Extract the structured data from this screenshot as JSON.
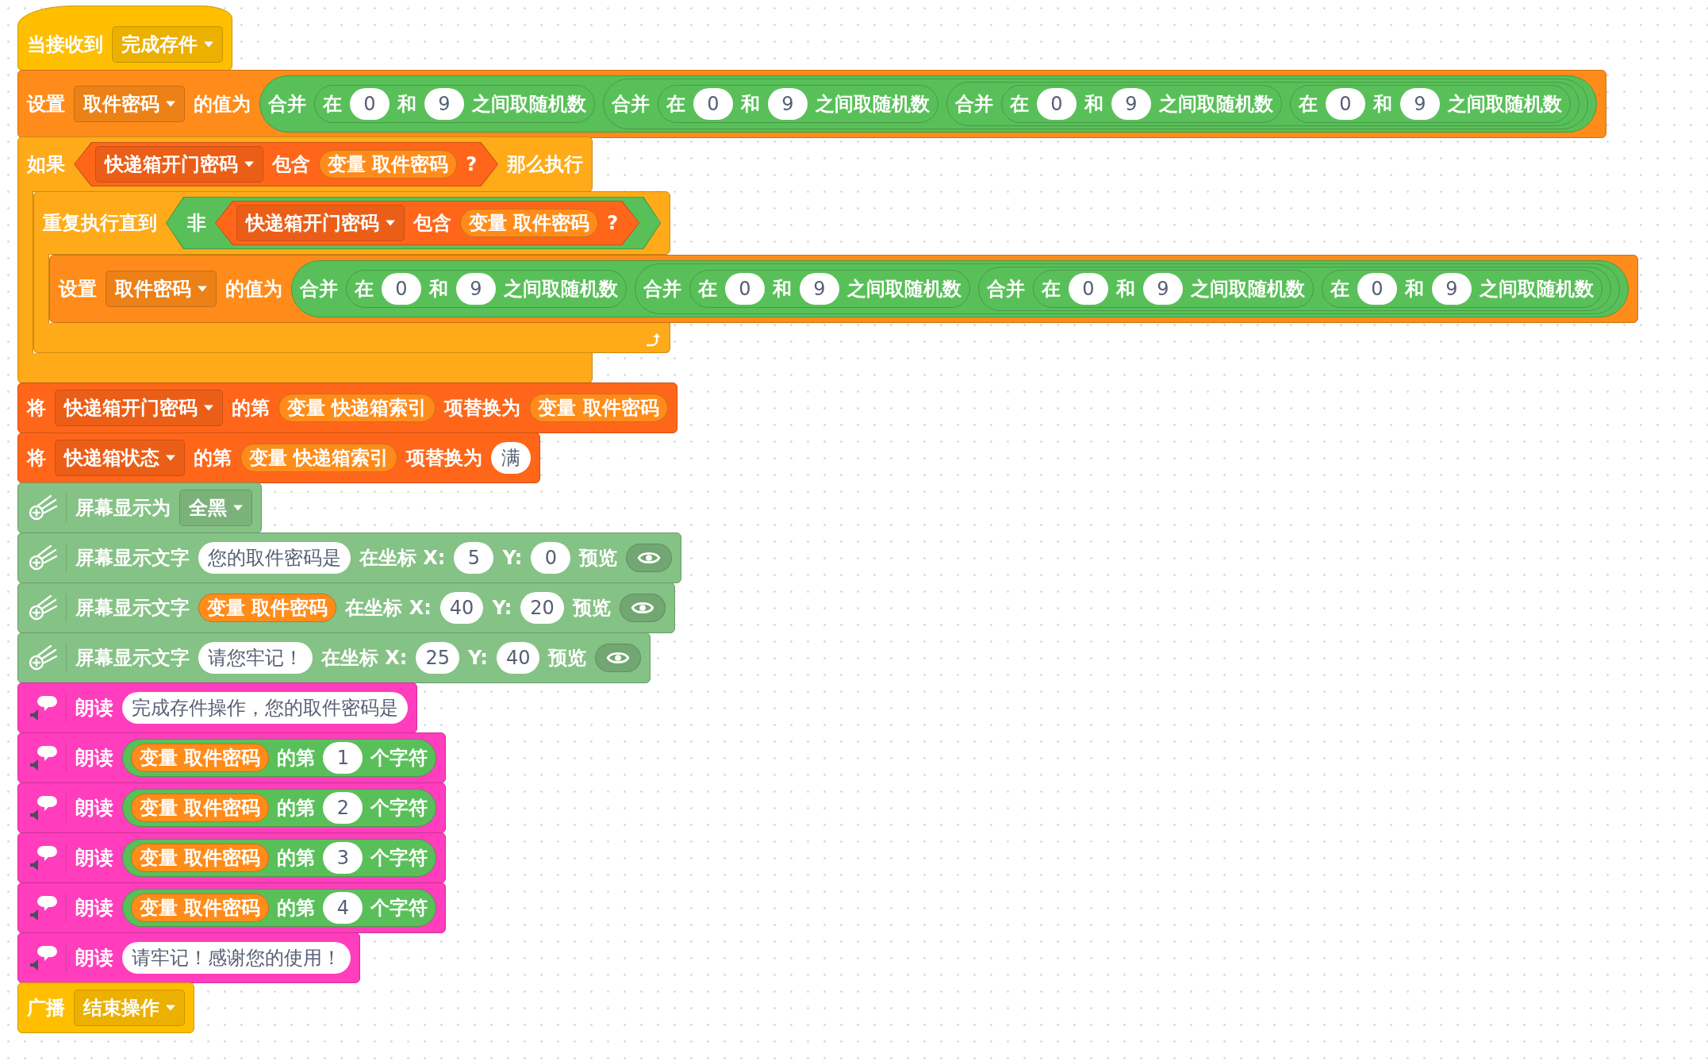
{
  "script": [
    {
      "kind": "hat",
      "color": "#ffbf00",
      "parts": [
        {
          "kind": "label",
          "text": "当接收到"
        },
        {
          "kind": "dropdown",
          "text": "完成存件"
        }
      ]
    },
    {
      "kind": "stack",
      "color": "#ff8c1a",
      "parts": [
        {
          "kind": "label",
          "text": "设置"
        },
        {
          "kind": "dropdown",
          "text": "取件密码"
        },
        {
          "kind": "label",
          "text": "的值为"
        },
        {
          "kind": "reporter",
          "color": "#59c059",
          "parts": [
            {
              "kind": "label",
              "text": "合并"
            },
            {
              "kind": "reporter",
              "color": "#59c059",
              "parts": [
                {
                  "kind": "label",
                  "text": "在"
                },
                {
                  "kind": "input",
                  "text": "0"
                },
                {
                  "kind": "label",
                  "text": "和"
                },
                {
                  "kind": "input",
                  "text": "9"
                },
                {
                  "kind": "label",
                  "text": "之间取随机数"
                }
              ]
            },
            {
              "kind": "reporter",
              "color": "#59c059",
              "parts": [
                {
                  "kind": "label",
                  "text": "合并"
                },
                {
                  "kind": "reporter",
                  "color": "#59c059",
                  "parts": [
                    {
                      "kind": "label",
                      "text": "在"
                    },
                    {
                      "kind": "input",
                      "text": "0"
                    },
                    {
                      "kind": "label",
                      "text": "和"
                    },
                    {
                      "kind": "input",
                      "text": "9"
                    },
                    {
                      "kind": "label",
                      "text": "之间取随机数"
                    }
                  ]
                },
                {
                  "kind": "reporter",
                  "color": "#59c059",
                  "parts": [
                    {
                      "kind": "label",
                      "text": "合并"
                    },
                    {
                      "kind": "reporter",
                      "color": "#59c059",
                      "parts": [
                        {
                          "kind": "label",
                          "text": "在"
                        },
                        {
                          "kind": "input",
                          "text": "0"
                        },
                        {
                          "kind": "label",
                          "text": "和"
                        },
                        {
                          "kind": "input",
                          "text": "9"
                        },
                        {
                          "kind": "label",
                          "text": "之间取随机数"
                        }
                      ]
                    },
                    {
                      "kind": "reporter",
                      "color": "#59c059",
                      "parts": [
                        {
                          "kind": "label",
                          "text": "在"
                        },
                        {
                          "kind": "input",
                          "text": "0"
                        },
                        {
                          "kind": "label",
                          "text": "和"
                        },
                        {
                          "kind": "input",
                          "text": "9"
                        },
                        {
                          "kind": "label",
                          "text": "之间取随机数"
                        }
                      ]
                    }
                  ]
                }
              ]
            }
          ]
        }
      ]
    },
    {
      "kind": "if",
      "color": "#ffab19",
      "parts": [
        {
          "kind": "label",
          "text": "如果"
        },
        {
          "kind": "boolean",
          "color": "#ff661a",
          "parts": [
            {
              "kind": "dropdown",
              "text": "快递箱开门密码"
            },
            {
              "kind": "label",
              "text": "包含"
            },
            {
              "kind": "reporter",
              "color": "#ff8c1a",
              "parts": [
                {
                  "kind": "label",
                  "text": "变量 取件密码"
                }
              ]
            },
            {
              "kind": "label",
              "text": "?"
            }
          ]
        },
        {
          "kind": "label",
          "text": "那么执行"
        }
      ],
      "body": [
        {
          "kind": "repeat",
          "color": "#ffab19",
          "parts": [
            {
              "kind": "label",
              "text": "重复执行直到"
            },
            {
              "kind": "boolean",
              "color": "#59c059",
              "parts": [
                {
                  "kind": "label",
                  "text": "非"
                },
                {
                  "kind": "boolean",
                  "color": "#ff661a",
                  "parts": [
                    {
                      "kind": "dropdown",
                      "text": "快递箱开门密码"
                    },
                    {
                      "kind": "label",
                      "text": "包含"
                    },
                    {
                      "kind": "reporter",
                      "color": "#ff8c1a",
                      "parts": [
                        {
                          "kind": "label",
                          "text": "变量 取件密码"
                        }
                      ]
                    },
                    {
                      "kind": "label",
                      "text": "?"
                    }
                  ]
                }
              ]
            }
          ],
          "body": [
            {
              "kind": "stack",
              "color": "#ff8c1a",
              "parts": [
                {
                  "kind": "label",
                  "text": "设置"
                },
                {
                  "kind": "dropdown",
                  "text": "取件密码"
                },
                {
                  "kind": "label",
                  "text": "的值为"
                },
                {
                  "kind": "reporter",
                  "color": "#59c059",
                  "parts": [
                    {
                      "kind": "label",
                      "text": "合并"
                    },
                    {
                      "kind": "reporter",
                      "color": "#59c059",
                      "parts": [
                        {
                          "kind": "label",
                          "text": "在"
                        },
                        {
                          "kind": "input",
                          "text": "0"
                        },
                        {
                          "kind": "label",
                          "text": "和"
                        },
                        {
                          "kind": "input",
                          "text": "9"
                        },
                        {
                          "kind": "label",
                          "text": "之间取随机数"
                        }
                      ]
                    },
                    {
                      "kind": "reporter",
                      "color": "#59c059",
                      "parts": [
                        {
                          "kind": "label",
                          "text": "合并"
                        },
                        {
                          "kind": "reporter",
                          "color": "#59c059",
                          "parts": [
                            {
                              "kind": "label",
                              "text": "在"
                            },
                            {
                              "kind": "input",
                              "text": "0"
                            },
                            {
                              "kind": "label",
                              "text": "和"
                            },
                            {
                              "kind": "input",
                              "text": "9"
                            },
                            {
                              "kind": "label",
                              "text": "之间取随机数"
                            }
                          ]
                        },
                        {
                          "kind": "reporter",
                          "color": "#59c059",
                          "parts": [
                            {
                              "kind": "label",
                              "text": "合并"
                            },
                            {
                              "kind": "reporter",
                              "color": "#59c059",
                              "parts": [
                                {
                                  "kind": "label",
                                  "text": "在"
                                },
                                {
                                  "kind": "input",
                                  "text": "0"
                                },
                                {
                                  "kind": "label",
                                  "text": "和"
                                },
                                {
                                  "kind": "input",
                                  "text": "9"
                                },
                                {
                                  "kind": "label",
                                  "text": "之间取随机数"
                                }
                              ]
                            },
                            {
                              "kind": "reporter",
                              "color": "#59c059",
                              "parts": [
                                {
                                  "kind": "label",
                                  "text": "在"
                                },
                                {
                                  "kind": "input",
                                  "text": "0"
                                },
                                {
                                  "kind": "label",
                                  "text": "和"
                                },
                                {
                                  "kind": "input",
                                  "text": "9"
                                },
                                {
                                  "kind": "label",
                                  "text": "之间取随机数"
                                }
                              ]
                            }
                          ]
                        }
                      ]
                    }
                  ]
                }
              ]
            }
          ]
        }
      ]
    },
    {
      "kind": "stack",
      "color": "#ff661a",
      "parts": [
        {
          "kind": "label",
          "text": "将"
        },
        {
          "kind": "dropdown",
          "text": "快递箱开门密码"
        },
        {
          "kind": "label",
          "text": "的第"
        },
        {
          "kind": "reporter",
          "color": "#ff8c1a",
          "parts": [
            {
              "kind": "label",
              "text": "变量 快递箱索引"
            }
          ]
        },
        {
          "kind": "label",
          "text": "项替换为"
        },
        {
          "kind": "reporter",
          "color": "#ff8c1a",
          "parts": [
            {
              "kind": "label",
              "text": "变量 取件密码"
            }
          ]
        }
      ]
    },
    {
      "kind": "stack",
      "color": "#ff661a",
      "parts": [
        {
          "kind": "label",
          "text": "将"
        },
        {
          "kind": "dropdown",
          "text": "快递箱状态"
        },
        {
          "kind": "label",
          "text": "的第"
        },
        {
          "kind": "reporter",
          "color": "#ff8c1a",
          "parts": [
            {
              "kind": "label",
              "text": "变量 快递箱索引"
            }
          ]
        },
        {
          "kind": "label",
          "text": "项替换为"
        },
        {
          "kind": "input",
          "text": "满"
        }
      ]
    },
    {
      "kind": "display",
      "color": "#85c285",
      "parts": [
        {
          "kind": "label",
          "text": "屏幕显示为"
        },
        {
          "kind": "dropdown",
          "text": "全黑"
        }
      ]
    },
    {
      "kind": "display",
      "color": "#85c285",
      "parts": [
        {
          "kind": "label",
          "text": "屏幕显示文字"
        },
        {
          "kind": "input",
          "text": "您的取件密码是"
        },
        {
          "kind": "label",
          "text": "在坐标 X:"
        },
        {
          "kind": "input",
          "text": "5"
        },
        {
          "kind": "label",
          "text": "Y:"
        },
        {
          "kind": "input",
          "text": "0"
        },
        {
          "kind": "label",
          "text": "预览"
        },
        {
          "kind": "preview",
          "on": true
        }
      ]
    },
    {
      "kind": "display",
      "color": "#85c285",
      "parts": [
        {
          "kind": "label",
          "text": "屏幕显示文字"
        },
        {
          "kind": "reporter",
          "color": "#ff8c1a",
          "parts": [
            {
              "kind": "label",
              "text": "变量 取件密码"
            }
          ]
        },
        {
          "kind": "label",
          "text": "在坐标 X:"
        },
        {
          "kind": "input",
          "text": "40"
        },
        {
          "kind": "label",
          "text": "Y:"
        },
        {
          "kind": "input",
          "text": "20"
        },
        {
          "kind": "label",
          "text": "预览"
        },
        {
          "kind": "preview",
          "on": true
        }
      ]
    },
    {
      "kind": "display",
      "color": "#85c285",
      "parts": [
        {
          "kind": "label",
          "text": "屏幕显示文字"
        },
        {
          "kind": "input",
          "text": "请您牢记！"
        },
        {
          "kind": "label",
          "text": "在坐标 X:"
        },
        {
          "kind": "input",
          "text": "25"
        },
        {
          "kind": "label",
          "text": "Y:"
        },
        {
          "kind": "input",
          "text": "40"
        },
        {
          "kind": "label",
          "text": "预览"
        },
        {
          "kind": "preview",
          "on": true
        }
      ]
    },
    {
      "kind": "speech",
      "color": "#ff3dbd",
      "parts": [
        {
          "kind": "label",
          "text": "朗读"
        },
        {
          "kind": "input",
          "text": "完成存件操作，您的取件密码是"
        }
      ]
    },
    {
      "kind": "speech",
      "color": "#ff3dbd",
      "parts": [
        {
          "kind": "label",
          "text": "朗读"
        },
        {
          "kind": "reporter",
          "color": "#59c059",
          "parts": [
            {
              "kind": "reporter",
              "color": "#ff8c1a",
              "parts": [
                {
                  "kind": "label",
                  "text": "变量 取件密码"
                }
              ]
            },
            {
              "kind": "label",
              "text": "的第"
            },
            {
              "kind": "input",
              "text": "1"
            },
            {
              "kind": "label",
              "text": "个字符"
            }
          ]
        }
      ]
    },
    {
      "kind": "speech",
      "color": "#ff3dbd",
      "parts": [
        {
          "kind": "label",
          "text": "朗读"
        },
        {
          "kind": "reporter",
          "color": "#59c059",
          "parts": [
            {
              "kind": "reporter",
              "color": "#ff8c1a",
              "parts": [
                {
                  "kind": "label",
                  "text": "变量 取件密码"
                }
              ]
            },
            {
              "kind": "label",
              "text": "的第"
            },
            {
              "kind": "input",
              "text": "2"
            },
            {
              "kind": "label",
              "text": "个字符"
            }
          ]
        }
      ]
    },
    {
      "kind": "speech",
      "color": "#ff3dbd",
      "parts": [
        {
          "kind": "label",
          "text": "朗读"
        },
        {
          "kind": "reporter",
          "color": "#59c059",
          "parts": [
            {
              "kind": "reporter",
              "color": "#ff8c1a",
              "parts": [
                {
                  "kind": "label",
                  "text": "变量 取件密码"
                }
              ]
            },
            {
              "kind": "label",
              "text": "的第"
            },
            {
              "kind": "input",
              "text": "3"
            },
            {
              "kind": "label",
              "text": "个字符"
            }
          ]
        }
      ]
    },
    {
      "kind": "speech",
      "color": "#ff3dbd",
      "parts": [
        {
          "kind": "label",
          "text": "朗读"
        },
        {
          "kind": "reporter",
          "color": "#59c059",
          "parts": [
            {
              "kind": "reporter",
              "color": "#ff8c1a",
              "parts": [
                {
                  "kind": "label",
                  "text": "变量 取件密码"
                }
              ]
            },
            {
              "kind": "label",
              "text": "的第"
            },
            {
              "kind": "input",
              "text": "4"
            },
            {
              "kind": "label",
              "text": "个字符"
            }
          ]
        }
      ]
    },
    {
      "kind": "speech",
      "color": "#ff3dbd",
      "parts": [
        {
          "kind": "label",
          "text": "朗读"
        },
        {
          "kind": "input",
          "text": "请牢记！感谢您的使用！"
        }
      ]
    },
    {
      "kind": "stack",
      "color": "#ffbf00",
      "parts": [
        {
          "kind": "label",
          "text": "广播"
        },
        {
          "kind": "dropdown",
          "text": "结束操作"
        }
      ]
    }
  ]
}
